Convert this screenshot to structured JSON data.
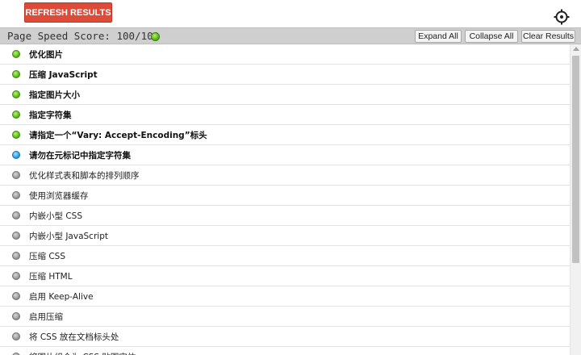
{
  "toolbar": {
    "refresh_label": "REFRESH RESULTS",
    "settings_icon": "gear-icon"
  },
  "summary": {
    "title": "Page Speed Score: 100/100",
    "score": 100,
    "score_status": "good",
    "expand_all_label": "Expand All",
    "collapse_all_label": "Collapse All",
    "clear_results_label": "Clear Results"
  },
  "colors": {
    "refresh_button": "#dd4b39",
    "status_green": "#5cbc1c",
    "status_blue": "#2aa0e6",
    "status_gray": "#9b9b9b",
    "header_bar": "#cfcfcf"
  },
  "rules": [
    {
      "label": "优化图片",
      "status": "green",
      "bold": true
    },
    {
      "label": "压缩 JavaScript",
      "status": "green",
      "bold": true
    },
    {
      "label": "指定图片大小",
      "status": "green",
      "bold": true
    },
    {
      "label": "指定字符集",
      "status": "green",
      "bold": true
    },
    {
      "label": "请指定一个“Vary: Accept-Encoding”标头",
      "status": "green",
      "bold": true
    },
    {
      "label": "请勿在元标记中指定字符集",
      "status": "blue",
      "bold": true
    },
    {
      "label": "优化样式表和脚本的排列顺序",
      "status": "gray",
      "bold": false
    },
    {
      "label": "使用浏览器缓存",
      "status": "gray",
      "bold": false
    },
    {
      "label": "内嵌小型 CSS",
      "status": "gray",
      "bold": false
    },
    {
      "label": "内嵌小型 JavaScript",
      "status": "gray",
      "bold": false
    },
    {
      "label": "压缩 CSS",
      "status": "gray",
      "bold": false
    },
    {
      "label": "压缩 HTML",
      "status": "gray",
      "bold": false
    },
    {
      "label": "启用 Keep-Alive",
      "status": "gray",
      "bold": false
    },
    {
      "label": "启用压缩",
      "status": "gray",
      "bold": false
    },
    {
      "label": "将 CSS 放在文档标头处",
      "status": "gray",
      "bold": false
    },
    {
      "label": "将图片组合为 CSS 贴图实体",
      "status": "gray",
      "bold": false
    }
  ]
}
